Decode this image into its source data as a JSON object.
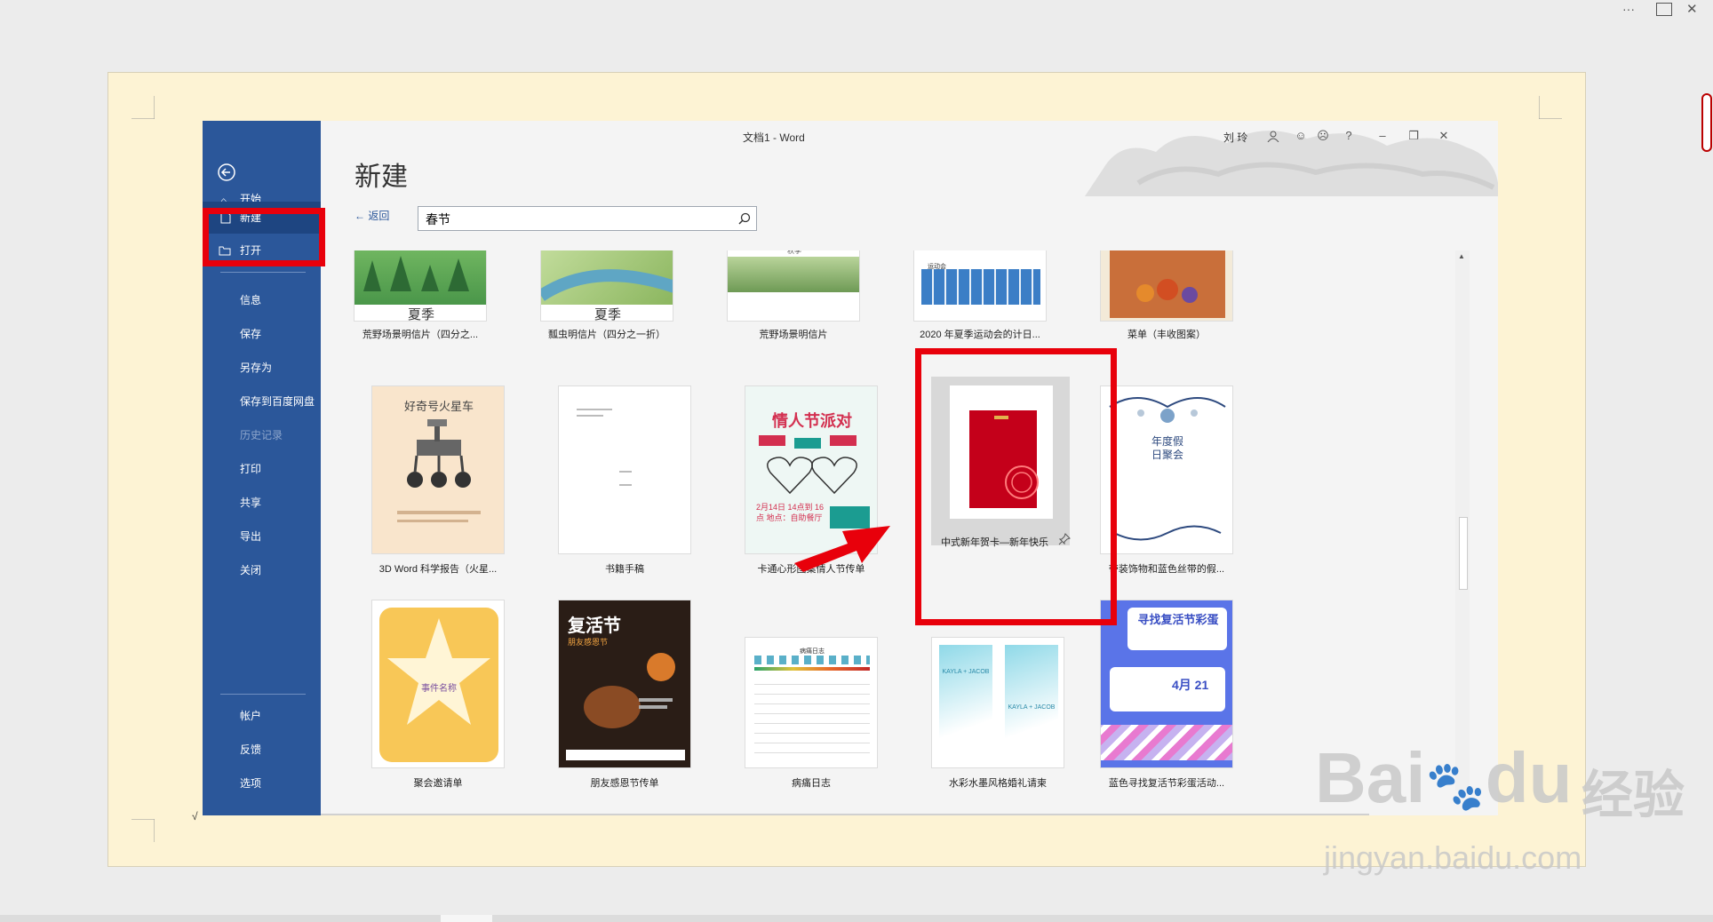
{
  "window": {
    "title": "文档1 - Word",
    "user": "刘 玲",
    "help": "?"
  },
  "sidebar": {
    "items": [
      {
        "label": "开始"
      },
      {
        "label": "新建"
      },
      {
        "label": "打开"
      },
      {
        "label": "信息"
      },
      {
        "label": "保存"
      },
      {
        "label": "另存为"
      },
      {
        "label": "保存到百度网盘"
      },
      {
        "label": "历史记录"
      },
      {
        "label": "打印"
      },
      {
        "label": "共享"
      },
      {
        "label": "导出"
      },
      {
        "label": "关闭"
      },
      {
        "label": "帐户"
      },
      {
        "label": "反馈"
      },
      {
        "label": "选项"
      }
    ]
  },
  "main": {
    "heading": "新建",
    "back_label": "返回",
    "search_value": "春节",
    "templates_row1": [
      {
        "name": "荒野场景明信片（四分之...",
        "caption": "夏季"
      },
      {
        "name": "瓢虫明信片（四分之一折）",
        "caption": "夏季"
      },
      {
        "name": "荒野场景明信片",
        "caption": "秋季"
      },
      {
        "name": "2020 年夏季运动会的计日...",
        "caption": "运动会"
      },
      {
        "name": "菜单（丰收图案）"
      }
    ],
    "templates_row2": [
      {
        "name": "3D Word 科学报告（火星...",
        "thumb_text": "好奇号火星车"
      },
      {
        "name": "书籍手稿"
      },
      {
        "name": "卡通心形图案情人节传单",
        "thumb_text": "情人节派对",
        "thumb_date": "2月14日 14点到 16点 地点：自助餐厅"
      },
      {
        "name": "中式新年贺卡—新年快乐"
      },
      {
        "name": "带装饰物和蓝色丝带的假...",
        "thumb_text": "年度假日聚会"
      }
    ],
    "templates_row3": [
      {
        "name": "聚会邀请单",
        "thumb_text": "事件名称"
      },
      {
        "name": "朋友感恩节传单",
        "thumb_text": "复活节",
        "thumb_sub": "朋友感恩节"
      },
      {
        "name": "病痛日志",
        "thumb_text": "病痛日志"
      },
      {
        "name": "水彩水墨风格婚礼请柬",
        "thumb_text": "KAYLA + JACOB"
      },
      {
        "name": "蓝色寻找复活节彩蛋活动...",
        "thumb_text": "寻找复活节彩蛋",
        "thumb_date": "4月 21"
      }
    ]
  },
  "watermark": {
    "brand": "Bai",
    "brand2": "du",
    "cn": "经验",
    "url": "jingyan.baidu.com"
  },
  "colors": {
    "sidebar": "#2b579a",
    "highlight": "#e8000b",
    "page": "#fdf3d4"
  }
}
